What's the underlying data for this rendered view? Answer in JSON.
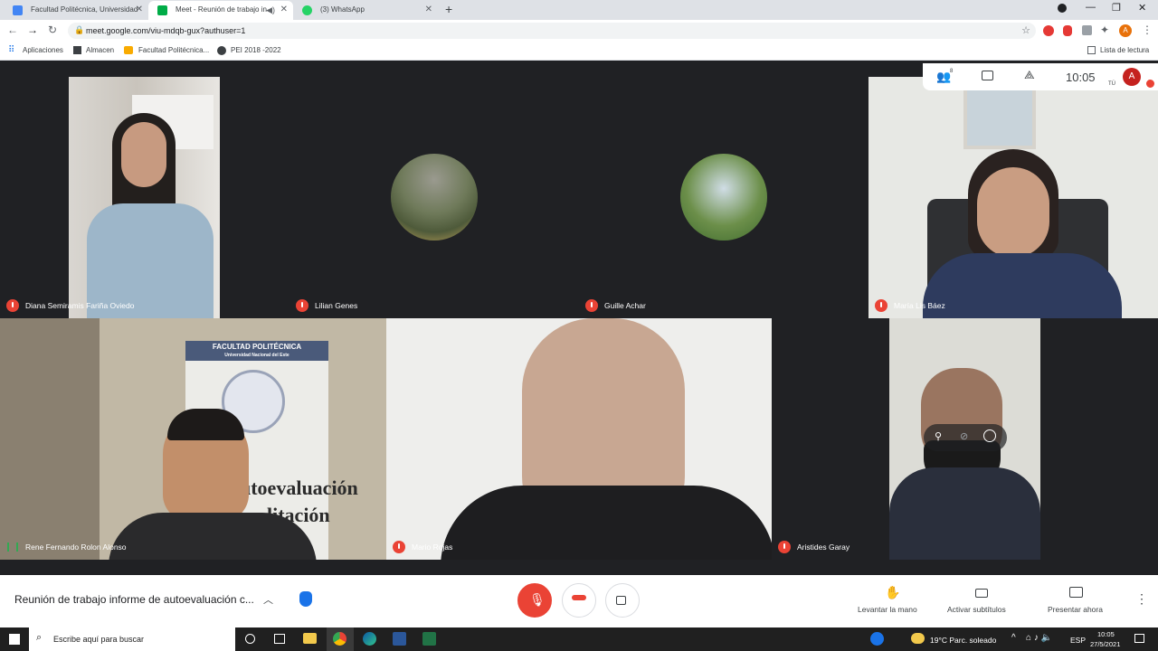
{
  "browser": {
    "tabs": [
      {
        "title": "Facultad Politécnica, Universidad",
        "favicon_color": "#4285f4"
      },
      {
        "title": "Meet - Reunión de trabajo in",
        "favicon_color": "#00ac47"
      },
      {
        "title": "(3) WhatsApp",
        "favicon_color": "#25d366"
      }
    ],
    "url": "meet.google.com/viu-mdqb-gux?authuser=1",
    "bookmarks": [
      "Aplicaciones",
      "Almacen",
      "Facultad Politécnica...",
      "PEI 2018 -2022"
    ],
    "reading_list": "Lista de lectura",
    "profile_initial": "A"
  },
  "meet": {
    "clock": "10:05",
    "people_count": "8",
    "you_label": "TÚ",
    "self_initial": "A",
    "participants": [
      {
        "name": "Diana Semiramis Fariña Oviedo",
        "muted": true
      },
      {
        "name": "Lilian Genes",
        "muted": true
      },
      {
        "name": "Guille Achar",
        "muted": true
      },
      {
        "name": "María Lis Báez",
        "muted": true
      },
      {
        "name": "Rene Fernando Rolon Alonso",
        "muted": false
      },
      {
        "name": "Mario Rojas",
        "muted": true
      },
      {
        "name": "Aristides Garay",
        "muted": true
      }
    ],
    "meeting_title": "Reunión de trabajo informe de autoevaluación c...",
    "actions": {
      "raise_hand": "Levantar la mano",
      "captions": "Activar subtítulos",
      "present": "Presentar ahora"
    },
    "banner_lines": [
      "FACULTAD POLITÉCNICA",
      "Universidad Nacional del Este"
    ],
    "banner_big": [
      "utoevaluación",
      "litación"
    ],
    "colors": {
      "red": "#ea4335",
      "dark": "#202124"
    }
  },
  "taskbar": {
    "search_placeholder": "Escribe aquí para buscar",
    "weather": "19°C  Parc. soleado",
    "lang": "ESP",
    "time": "10:05",
    "date": "27/5/2021"
  }
}
